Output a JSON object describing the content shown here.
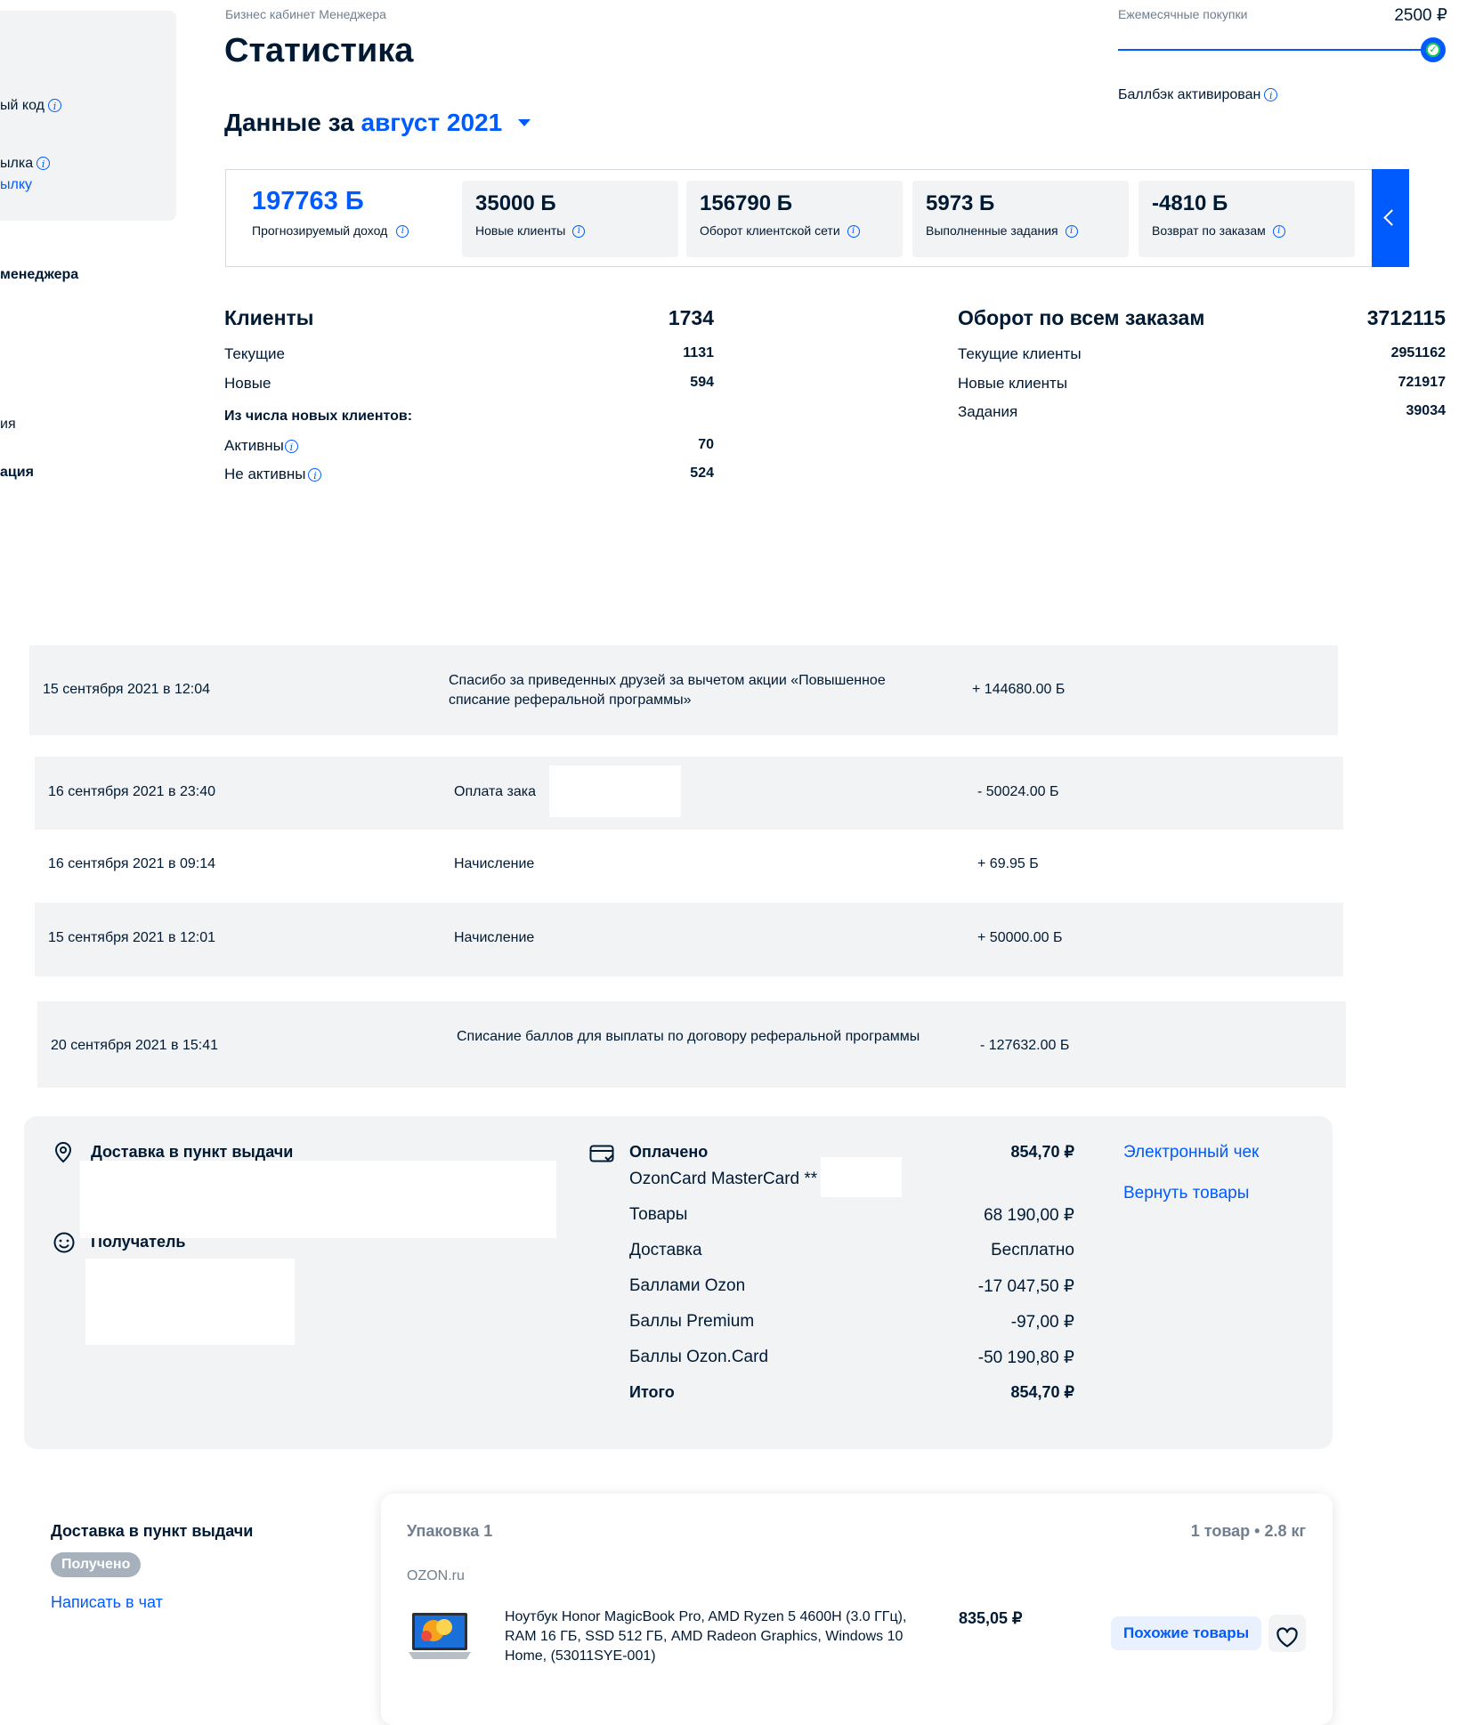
{
  "sidebar": {
    "fragments": [
      "ый код",
      "ылка",
      "ылку",
      "менеджера",
      "ия",
      "ация"
    ]
  },
  "header": {
    "breadcrumb": "Бизнес кабинет Менеджера",
    "title": "Статистика",
    "period_prefix": "Данные за",
    "period_value": "август 2021"
  },
  "monthly": {
    "label": "Ежемесячные покупки",
    "value": "2500 ₽",
    "progress_fraction": 1.0,
    "cashback_label": "Баллбэк активирован"
  },
  "stats": {
    "main": {
      "value": "197763 Б",
      "label": "Прогнозируемый доход"
    },
    "cards": [
      {
        "value": "35000 Б",
        "label": "Новые клиенты"
      },
      {
        "value": "156790 Б",
        "label": "Оборот клиентской сети"
      },
      {
        "value": "5973 Б",
        "label": "Выполненные задания"
      },
      {
        "value": "-4810 Б",
        "label": "Возврат по заказам"
      }
    ]
  },
  "clients": {
    "title": "Клиенты",
    "total": "1734",
    "rows": [
      {
        "label": "Текущие",
        "value": "1131"
      },
      {
        "label": "Новые",
        "value": "594"
      }
    ],
    "sub_heading": "Из числа новых клиентов:",
    "sub_rows": [
      {
        "label": "Активны",
        "value": "70"
      },
      {
        "label": "Не активны",
        "value": "524"
      }
    ]
  },
  "turnover": {
    "title": "Оборот по всем заказам",
    "total": "3712115",
    "rows": [
      {
        "label": "Текущие клиенты",
        "value": "2951162"
      },
      {
        "label": "Новые клиенты",
        "value": "721917"
      },
      {
        "label": "Задания",
        "value": "39034"
      }
    ]
  },
  "transactions": [
    {
      "date": "15 сентября 2021 в 12:04",
      "desc": "Спасибо за приведенных друзей за вычетом акции «Повышенное списание реферальной программы»",
      "amount": "+ 144680.00 Б"
    },
    {
      "date": "16 сентября 2021 в 23:40",
      "desc": "Оплата зака",
      "amount": "- 50024.00 Б"
    },
    {
      "date": "16 сентября 2021 в 09:14",
      "desc": "Начисление",
      "amount": "+ 69.95 Б"
    },
    {
      "date": "15 сентября 2021 в 12:01",
      "desc": "Начисление",
      "amount": "+ 50000.00 Б"
    },
    {
      "date": "20 сентября 2021 в 15:41",
      "desc": "Списание баллов для выплаты по договору реферальной программы",
      "amount": "- 127632.00 Б"
    }
  ],
  "order": {
    "delivery_heading": "Доставка в пункт выдачи",
    "recipient_heading": "Получатель",
    "paid_heading": "Оплачено",
    "paid_total": "854,70 ₽",
    "card": "OzonCard MasterCard **",
    "lines": [
      {
        "label": "Товары",
        "value": "68 190,00 ₽"
      },
      {
        "label": "Доставка",
        "value": "Бесплатно"
      },
      {
        "label": "Баллами Ozon",
        "value": "-17 047,50 ₽"
      },
      {
        "label": "Баллы Premium",
        "value": "-97,00 ₽"
      },
      {
        "label": "Баллы Ozon.Card",
        "value": "-50 190,80 ₽"
      }
    ],
    "total_label": "Итого",
    "total_value": "854,70 ₽",
    "links": [
      "Электронный чек",
      "Вернуть товары"
    ]
  },
  "package": {
    "left_heading": "Доставка в пункт выдачи",
    "status": "Получено",
    "chat_link": "Написать в чат",
    "title": "Упаковка 1",
    "meta": "1 товар • 2.8 кг",
    "seller": "OZON.ru",
    "product_name": "Ноутбук Honor MagicBook Pro, AMD Ryzen 5 4600H (3.0 ГГц), RAM 16 ГБ, SSD 512 ГБ, AMD Radeon Graphics, Windows 10 Home, (53011SYE-001)",
    "price": "835,05 ₽",
    "similar_button": "Похожие товары"
  },
  "colors": {
    "accent": "#005bff",
    "text": "#001a34",
    "panel": "#f2f3f5",
    "muted": "#707f8d"
  },
  "icons": [
    "info-icon",
    "check-icon",
    "chevron-left-icon",
    "caret-down-icon",
    "location-pin-icon",
    "smile-icon",
    "card-icon",
    "heart-icon"
  ]
}
